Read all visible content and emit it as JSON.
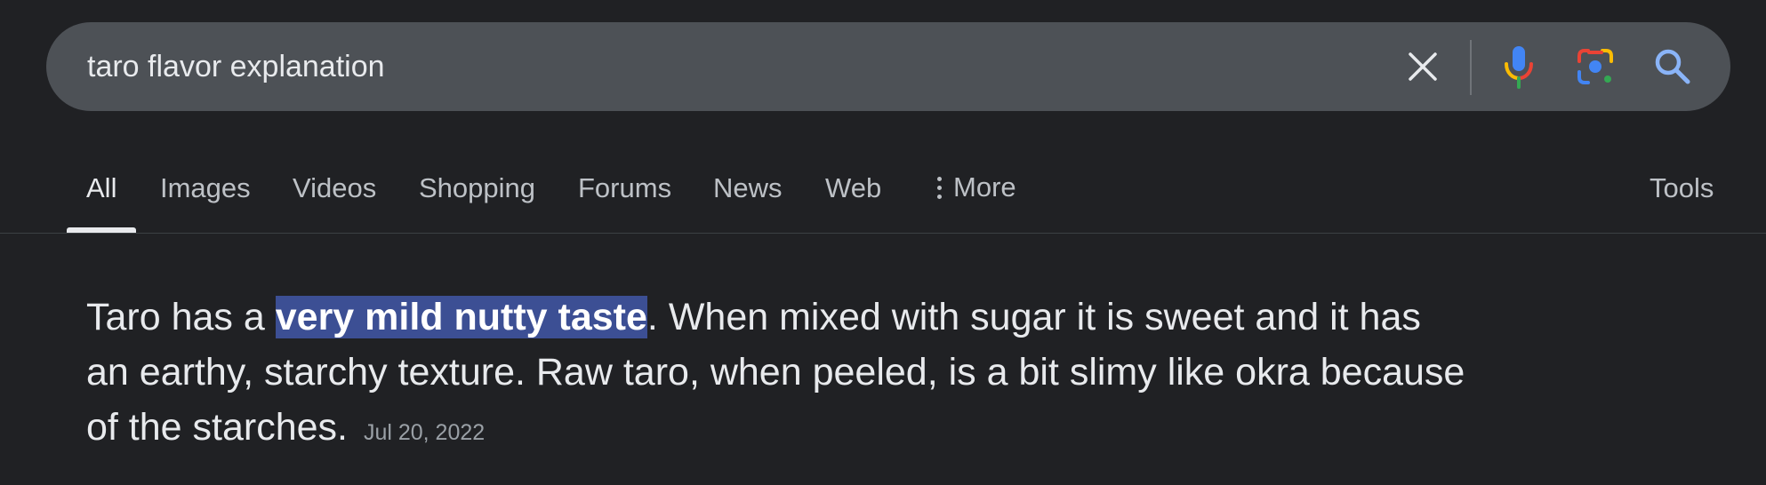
{
  "search": {
    "query": "taro flavor explanation",
    "clear_icon": "close-icon",
    "voice_icon": "microphone-icon",
    "lens_icon": "camera-lens-icon",
    "search_icon": "search-icon",
    "colors": {
      "bar_background": "#4d5156",
      "search_icon": "#8ab4f8",
      "google_blue": "#4285f4",
      "google_red": "#ea4335",
      "google_yellow": "#fbbc04",
      "google_green": "#34a853"
    }
  },
  "tabs": {
    "items": [
      {
        "label": "All",
        "active": true
      },
      {
        "label": "Images",
        "active": false
      },
      {
        "label": "Videos",
        "active": false
      },
      {
        "label": "Shopping",
        "active": false
      },
      {
        "label": "Forums",
        "active": false
      },
      {
        "label": "News",
        "active": false
      },
      {
        "label": "Web",
        "active": false
      },
      {
        "label": "More",
        "active": false
      }
    ],
    "tools_label": "Tools",
    "more_icon": "more-vertical-icon"
  },
  "snippet": {
    "text_before": "Taro has a ",
    "highlight": "very mild nutty taste",
    "text_after": ". When mixed with sugar it is sweet and it has an earthy, starchy texture. Raw taro, when peeled, is a bit slimy like okra because of the starches.",
    "date": "Jul 20, 2022",
    "highlight_color": "#3c4f94"
  },
  "theme": {
    "background": "#202124",
    "text_primary": "#e8eaed",
    "text_secondary": "#bdc1c6"
  }
}
